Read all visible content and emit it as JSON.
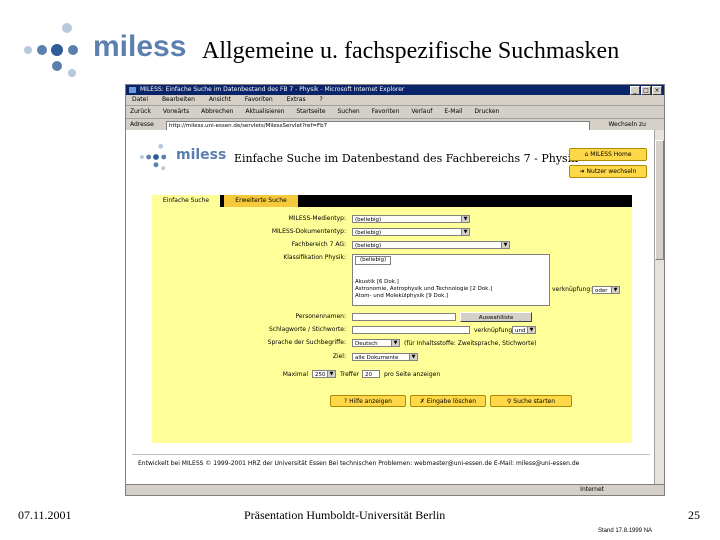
{
  "slide": {
    "logo_text": "miless",
    "title": "Allgemeine u. fachspezifische Suchmasken",
    "date": "07.11.2001",
    "footer": "Präsentation Humboldt-Universität Berlin",
    "page_number": "25",
    "stand": "Stand 17.8.1999 NA"
  },
  "browser": {
    "title": "MILESS: Einfache Suche im Datenbestand des FB 7 - Physik - Microsoft Internet Explorer",
    "menu": [
      "Datei",
      "Bearbeiten",
      "Ansicht",
      "Favoriten",
      "Extras",
      "?"
    ],
    "toolbar": [
      "Zurück",
      "Vorwärts",
      "Abbrechen",
      "Aktualisieren",
      "Startseite",
      "Suchen",
      "Favoriten",
      "Verlauf",
      "E-Mail",
      "Drucken"
    ],
    "address_label": "Adresse",
    "address": "http://miless.uni-essen.de/servlets/MilessServlet?ref=Fb7",
    "go_label": "Wechseln zu",
    "status_zone": "Internet"
  },
  "page": {
    "logo_text": "miless",
    "heading": "Einfache Suche im Datenbestand des Fachbereichs 7 - Physik",
    "home_button": "MILESS Home",
    "user_button": "Nutzer wechseln",
    "tabs": [
      "Einfache Suche",
      "Erweiterte Suche"
    ],
    "fields": {
      "medientyp_label": "MILESS-Medientyp:",
      "medientyp_value": "(beliebig)",
      "dokumenttyp_label": "MILESS-Dokumententyp:",
      "dokumenttyp_value": "(beliebig)",
      "fachbereich_label": "Fachbereich 7 AG:",
      "fachbereich_value": "(beliebig)",
      "klassifikation_label": "Klassifikation Physik:",
      "klassifikation_items": [
        "(beliebig)",
        "",
        "",
        "Akustik [6 Dok.]",
        "Astronomie, Astrophysik und Technologie [2 Dok.]",
        "Atom- und Molekülphysik [9 Dok.]"
      ],
      "verknuepfung_label": "verknüpfung:",
      "verknuepfung_value": "oder",
      "personen_label": "Personennamen:",
      "auswahlliste_button": "Auswahlliste",
      "schlagworte_label": "Schlagworte / Stichworte:",
      "verknuepfung2_label": "verknüpfung:",
      "verknuepfung2_value": "und",
      "sprache_label": "Sprache der Suchbegriffe:",
      "sprache_value": "Deutsch",
      "sprache_hint": "(für Inhaltsstoffe: Zweitsprache, Stichworte)",
      "ziel_label": "Ziel:",
      "ziel_value": "alle Dokumente",
      "maximal_label": "Maximal",
      "maximal_value": "250",
      "treffer_label": "Treffer",
      "treffer_value": "20",
      "treffer_suffix": "pro Seite anzeigen"
    },
    "buttons": {
      "help": "Hilfe anzeigen",
      "clear": "Eingabe löschen",
      "search": "Suche starten"
    },
    "footer_text": "Entwickelt bei MILESS © 1999-2001 HRZ der Universität Essen    Bei technischen Problemen: webmaster@uni-essen.de    E-Mail: miless@uni-essen.de"
  }
}
